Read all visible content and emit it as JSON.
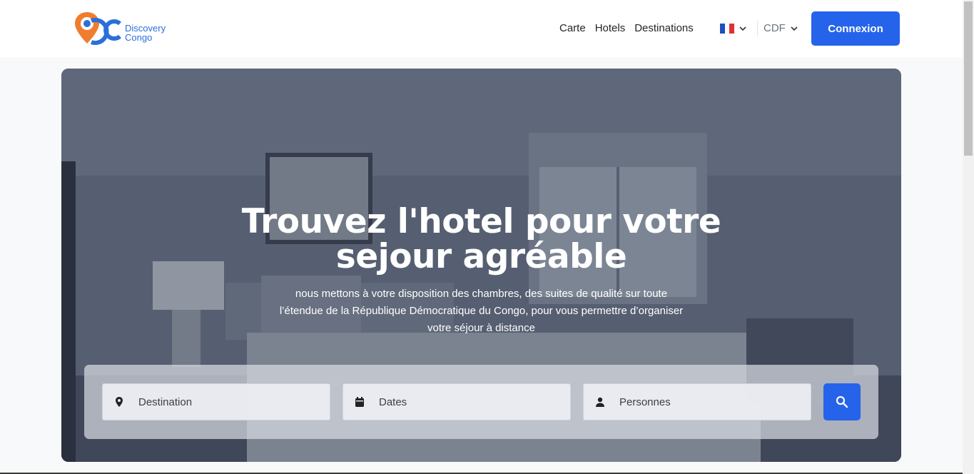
{
  "brand": {
    "line1": "Discovery",
    "line2": "Congo"
  },
  "nav": {
    "items": [
      "Carte",
      "Hotels",
      "Destinations"
    ]
  },
  "language": {
    "flag": "fr-flag-icon"
  },
  "currency": {
    "label": "CDF"
  },
  "login": {
    "label": "Connexion"
  },
  "hero": {
    "title_line1": "Trouvez l'hotel pour votre",
    "title_line2": "sejour agréable",
    "subtitle": "nous mettons à votre disposition des chambres, des suites de qualité sur toute l’étendue de la République Démocratique du Congo, pour vous permettre d’organiser votre séjour à distance"
  },
  "search": {
    "destination_placeholder": "Destination",
    "dates_placeholder": "Dates",
    "persons_placeholder": "Personnes"
  },
  "colors": {
    "accent": "#2563eb",
    "brand_orange": "#f07d2e",
    "brand_blue": "#2a6fdb"
  }
}
